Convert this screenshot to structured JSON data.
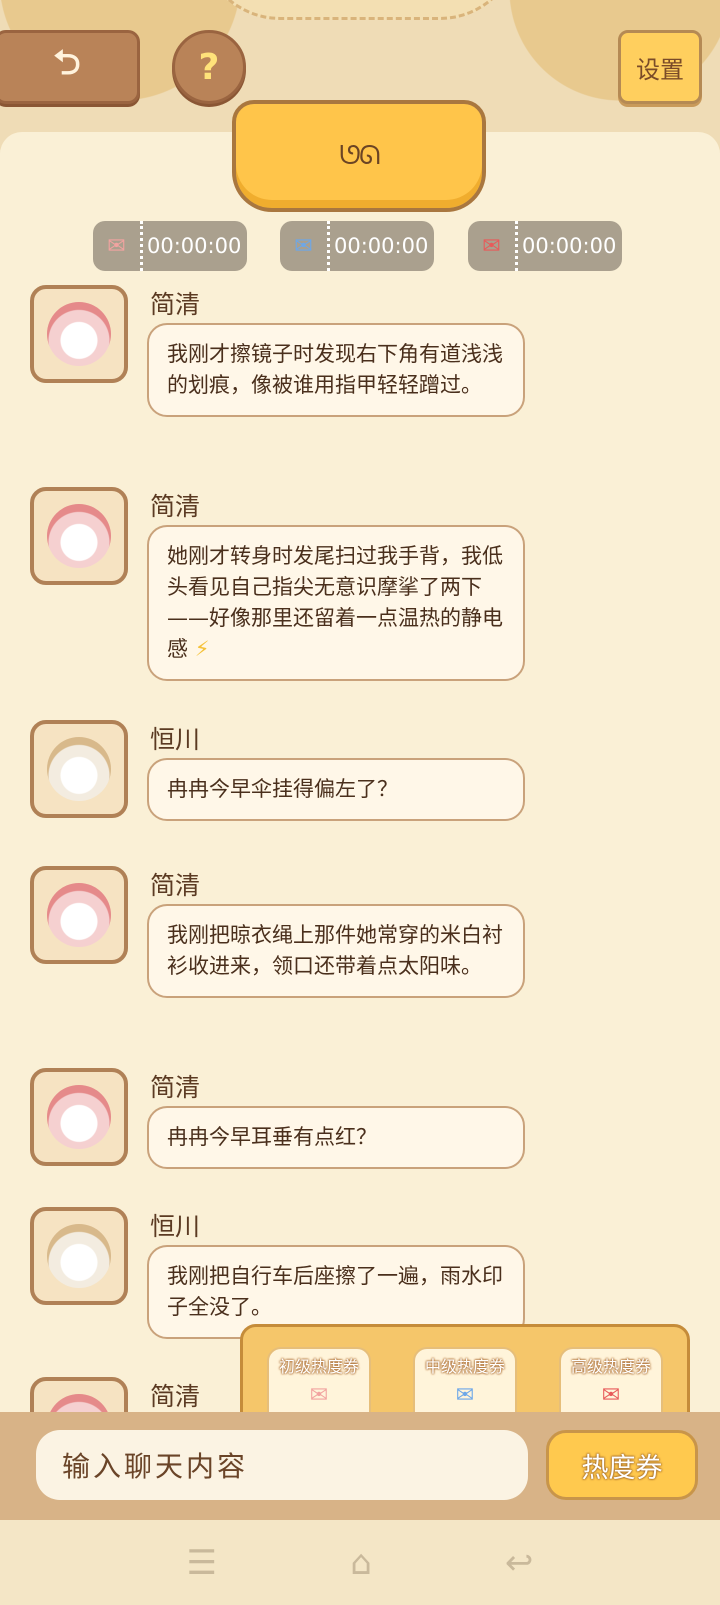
{
  "header": {
    "back_icon": "back-arrow-icon",
    "help_label": "?",
    "settings_label": "设置"
  },
  "emotion_tag": {
    "face": "ᘎᘏ"
  },
  "timers": [
    {
      "ticket": "junior-ticket-icon",
      "time": "00:00:00"
    },
    {
      "ticket": "mid-ticket-icon",
      "time": "00:00:00"
    },
    {
      "ticket": "senior-ticket-icon",
      "time": "00:00:00"
    }
  ],
  "messages": [
    {
      "name": "简清",
      "avatar": "jianqing-avatar",
      "text": "我刚才擦镜子时发现右下角有道浅浅的划痕，像被谁用指甲轻轻蹭过。"
    },
    {
      "name": "简清",
      "avatar": "jianqing-avatar",
      "text": "她刚才转身时发尾扫过我手背，我低头看见自己指尖无意识摩挲了两下——好像那里还留着一点温热的静电感",
      "emoji": "⚡"
    },
    {
      "name": "恒川",
      "avatar": "hengchuan-avatar",
      "text": "冉冉今早伞挂得偏左了？"
    },
    {
      "name": "简清",
      "avatar": "jianqing-avatar",
      "text": "我刚把晾衣绳上那件她常穿的米白衬衫收进来，领口还带着点太阳味。"
    },
    {
      "name": "简清",
      "avatar": "jianqing-avatar",
      "text": "冉冉今早耳垂有点红？"
    },
    {
      "name": "恒川",
      "avatar": "hengchuan-avatar",
      "text": "我刚把自行车后座擦了一遍，雨水印子全没了。"
    },
    {
      "name": "简清",
      "avatar": "jianqing-avatar",
      "text": ""
    }
  ],
  "ticket_panel": [
    {
      "label": "初级热度券",
      "pic": "✉"
    },
    {
      "label": "中级热度券",
      "pic": "✉"
    },
    {
      "label": "高级热度券",
      "pic": "✉"
    }
  ],
  "input": {
    "placeholder": "输入聊天内容"
  },
  "heat_button_label": "热度券",
  "nav": {
    "menu": "☰",
    "home": "⌂",
    "back": "↩"
  }
}
